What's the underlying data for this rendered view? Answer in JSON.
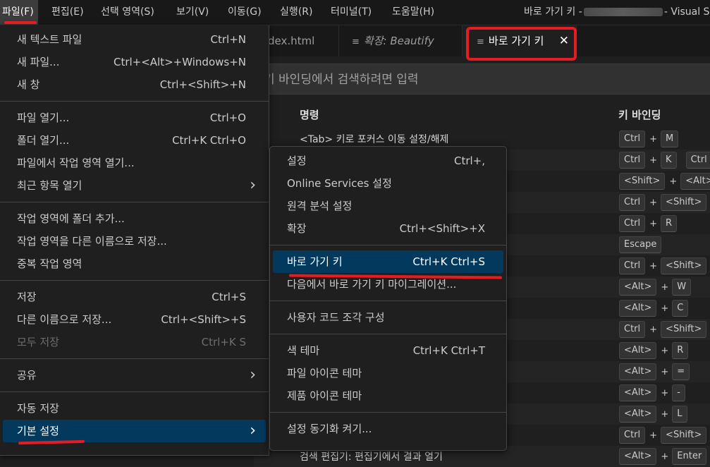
{
  "menubar": {
    "items": [
      "파일(F)",
      "편집(E)",
      "선택 영역(S)",
      "보기(V)",
      "이동(G)",
      "실행(R)",
      "터미널(T)",
      "도움말(H)"
    ],
    "title_prefix": "바로 가기 키 -",
    "title_suffix": "- Visual Stu"
  },
  "tabs": [
    {
      "label": "dex.html",
      "icon": "",
      "italic": false
    },
    {
      "label": "확장: Beautify",
      "icon": "list-icon",
      "italic": true
    },
    {
      "label": "바로 가기 키",
      "icon": "list-icon",
      "italic": false,
      "active": true,
      "close": "✕"
    }
  ],
  "search": {
    "placeholder": "키 바인딩에서 검색하려면 입력"
  },
  "table": {
    "headers": {
      "command": "명령",
      "keybinding": "키 바인딩"
    },
    "rows": [
      {
        "command": "<Tab> 키로 포커스 이동 설정/해제",
        "keys": [
          [
            "Ctrl",
            "M"
          ]
        ]
      },
      {
        "command": "",
        "keys": [
          [
            "Ctrl",
            "K"
          ],
          [
            "Ctrl"
          ]
        ]
      },
      {
        "command": "",
        "keys": [
          [
            "<Shift>",
            "<Alt>"
          ]
        ]
      },
      {
        "command": "",
        "keys": [
          [
            "Ctrl",
            "<Shift>"
          ]
        ]
      },
      {
        "command": "",
        "keys": [
          [
            "Ctrl",
            "R"
          ]
        ]
      },
      {
        "command": "",
        "keys": [
          [
            "Escape"
          ]
        ]
      },
      {
        "command": "",
        "keys": [
          [
            "Ctrl",
            "<Shift>"
          ]
        ]
      },
      {
        "command": "",
        "keys": [
          [
            "<Alt>",
            "W"
          ]
        ]
      },
      {
        "command": "",
        "keys": [
          [
            "<Alt>",
            "C"
          ]
        ]
      },
      {
        "command": "",
        "keys": [
          [
            "Ctrl",
            "<Shift>"
          ]
        ]
      },
      {
        "command": "",
        "keys": [
          [
            "<Alt>",
            "R"
          ]
        ]
      },
      {
        "command": "",
        "keys": [
          [
            "<Alt>",
            "="
          ]
        ]
      },
      {
        "command": "",
        "keys": [
          [
            "<Alt>",
            "-"
          ]
        ]
      },
      {
        "command": "",
        "keys": [
          [
            "<Alt>",
            "L"
          ]
        ]
      },
      {
        "command": "",
        "keys": [
          [
            "Ctrl",
            "<Shift>"
          ]
        ]
      },
      {
        "command": "검색 편집기: 편집기에서 결과 열기",
        "keys": [
          [
            "<Alt>",
            "Enter"
          ]
        ]
      }
    ]
  },
  "file_menu": {
    "groups": [
      [
        {
          "label": "새 텍스트 파일",
          "shortcut": "Ctrl+N"
        },
        {
          "label": "새 파일...",
          "shortcut": "Ctrl+<Alt>+Windows+N"
        },
        {
          "label": "새 창",
          "shortcut": "Ctrl+<Shift>+N"
        }
      ],
      [
        {
          "label": "파일 열기...",
          "shortcut": "Ctrl+O"
        },
        {
          "label": "폴더 열기...",
          "shortcut": "Ctrl+K Ctrl+O"
        },
        {
          "label": "파일에서 작업 영역 열기...",
          "shortcut": ""
        },
        {
          "label": "최근 항목 열기",
          "shortcut": "",
          "submenu": true
        }
      ],
      [
        {
          "label": "작업 영역에 폴더 추가...",
          "shortcut": ""
        },
        {
          "label": "작업 영역을 다른 이름으로 저장...",
          "shortcut": ""
        },
        {
          "label": "중복 작업 영역",
          "shortcut": ""
        }
      ],
      [
        {
          "label": "저장",
          "shortcut": "Ctrl+S"
        },
        {
          "label": "다른 이름으로 저장...",
          "shortcut": "Ctrl+<Shift>+S"
        },
        {
          "label": "모두 저장",
          "shortcut": "Ctrl+K S",
          "disabled": true
        }
      ],
      [
        {
          "label": "공유",
          "shortcut": "",
          "submenu": true
        }
      ],
      [
        {
          "label": "자동 저장",
          "shortcut": ""
        },
        {
          "label": "기본 설정",
          "shortcut": "",
          "submenu": true,
          "highlighted": true
        }
      ]
    ]
  },
  "preferences_menu": {
    "groups": [
      [
        {
          "label": "설정",
          "shortcut": "Ctrl+,"
        },
        {
          "label": "Online Services 설정",
          "shortcut": ""
        },
        {
          "label": "원격 분석 설정",
          "shortcut": ""
        },
        {
          "label": "확장",
          "shortcut": "Ctrl+<Shift>+X"
        }
      ],
      [
        {
          "label": "바로 가기 키",
          "shortcut": "Ctrl+K Ctrl+S",
          "highlighted": true
        },
        {
          "label": "다음에서 바로 가기 키 마이그레이션...",
          "shortcut": ""
        }
      ],
      [
        {
          "label": "사용자 코드 조각 구성",
          "shortcut": ""
        }
      ],
      [
        {
          "label": "색 테마",
          "shortcut": "Ctrl+K Ctrl+T"
        },
        {
          "label": "파일 아이콘 테마",
          "shortcut": ""
        },
        {
          "label": "제품 아이콘 테마",
          "shortcut": ""
        }
      ],
      [
        {
          "label": "설정 동기화 켜기...",
          "shortcut": ""
        }
      ]
    ]
  },
  "colors": {
    "highlight": "#04395e",
    "annotation": "#e51c23",
    "background": "#1f1f1f"
  }
}
